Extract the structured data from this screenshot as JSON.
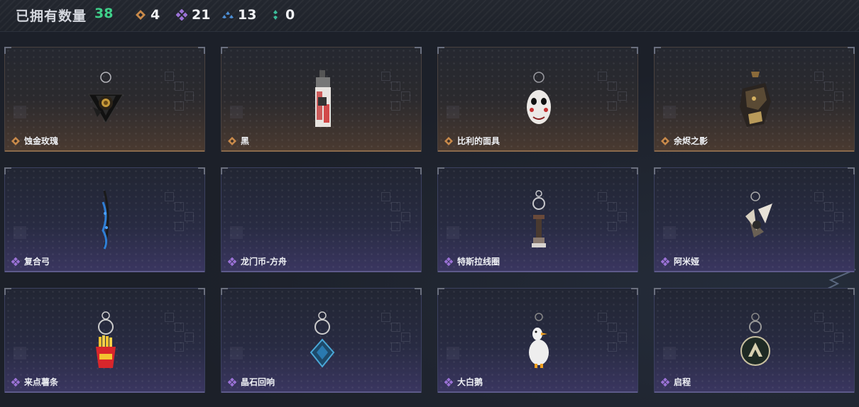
{
  "header": {
    "owned_label": "已拥有数量",
    "owned_count": "38",
    "stats": [
      {
        "icon": "orange-rarity-gem-icon",
        "color": "#c98a4a",
        "count": "4"
      },
      {
        "icon": "purple-rarity-gem-icon",
        "color": "#9b72d6",
        "count": "21"
      },
      {
        "icon": "blue-rarity-gem-icon",
        "color": "#4d8fd6",
        "count": "13"
      },
      {
        "icon": "green-rarity-gem-icon",
        "color": "#3bbd9a",
        "count": "0"
      }
    ]
  },
  "items": [
    {
      "name": "蚀金玫瑰",
      "rarity": "gold",
      "icon": "gilded-rose-charm-icon"
    },
    {
      "name": "黑",
      "rarity": "gold",
      "icon": "black-device-charm-icon"
    },
    {
      "name": "比利的面具",
      "rarity": "gold",
      "icon": "billy-mask-charm-icon"
    },
    {
      "name": "余烬之影",
      "rarity": "gold",
      "icon": "ember-shadow-charm-icon"
    },
    {
      "name": "复合弓",
      "rarity": "purple",
      "icon": "compound-bow-charm-icon"
    },
    {
      "name": "龙门币-方舟",
      "rarity": "purple",
      "icon": "lungmen-coin-charm-icon"
    },
    {
      "name": "特斯拉线圈",
      "rarity": "purple",
      "icon": "tesla-coil-charm-icon"
    },
    {
      "name": "阿米娅",
      "rarity": "purple",
      "icon": "amiya-charm-icon"
    },
    {
      "name": "来点薯条",
      "rarity": "purple",
      "icon": "fries-charm-icon"
    },
    {
      "name": "晶石回响",
      "rarity": "purple",
      "icon": "crystal-echo-charm-icon"
    },
    {
      "name": "大白鹅",
      "rarity": "purple",
      "icon": "white-goose-charm-icon"
    },
    {
      "name": "启程",
      "rarity": "purple",
      "icon": "departure-medallion-charm-icon"
    }
  ]
}
